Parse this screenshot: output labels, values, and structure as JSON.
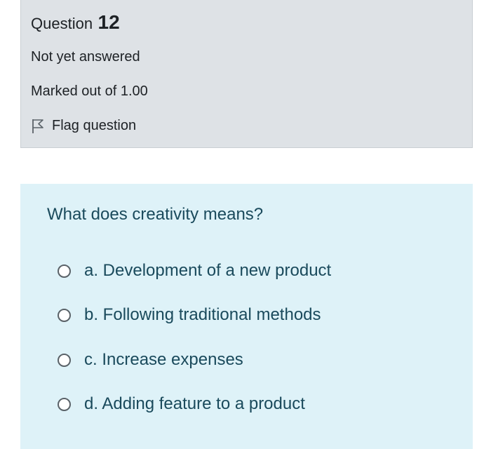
{
  "question": {
    "label": "Question",
    "number": "12",
    "state": "Not yet answered",
    "grade": "Marked out of 1.00",
    "flag_label": "Flag question",
    "flag_icon": "flag-outline-icon",
    "text": "What does creativity means?"
  },
  "options": [
    {
      "label": "a. Development of a new product",
      "selected": false
    },
    {
      "label": "b. Following traditional methods",
      "selected": false
    },
    {
      "label": "c. Increase expenses",
      "selected": false
    },
    {
      "label": "d. Adding feature to a product",
      "selected": false
    }
  ],
  "colors": {
    "info_background": "#dee2e6",
    "content_background": "#def2f8",
    "question_text": "#1a4a5c"
  }
}
